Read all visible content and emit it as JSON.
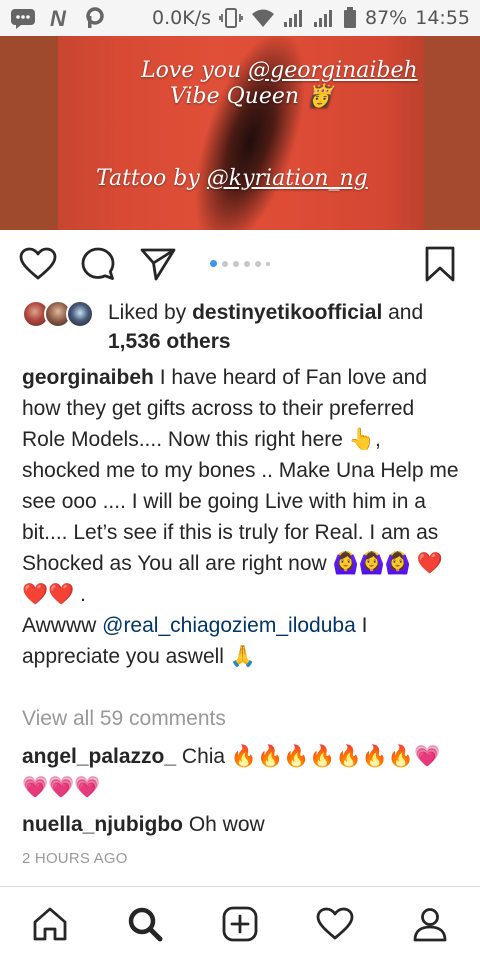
{
  "status_bar": {
    "network_speed": "0.0K/s",
    "battery": "87%",
    "time": "14:55",
    "left_icons": [
      "message-icon",
      "n-app-icon",
      "p-app-icon"
    ],
    "right_icons": [
      "vibrate-icon",
      "wifi-icon",
      "signal-icon",
      "signal-icon-2",
      "battery-icon"
    ]
  },
  "post_image": {
    "line1_prefix": "Love you ",
    "line1_handle": "@georginaibeh",
    "line2": "Vibe Queen 👸",
    "line3_prefix": "Tattoo by ",
    "line3_handle": "@kyriation_ng"
  },
  "actions": {
    "icons": [
      "heart-icon",
      "comment-icon",
      "share-icon",
      "bookmark-icon"
    ],
    "carousel_dots": 6,
    "active_dot": 0
  },
  "likes": {
    "liked_by_prefix": "Liked by ",
    "liked_by_user": "destinyetikoofficial",
    "and_text": " and",
    "others_count": "1,536 others"
  },
  "caption": {
    "username": "georginaibeh",
    "text": " I have heard of Fan love and how they get gifts across to their preferred Role Models.... Now this right here 👆, shocked me to my bones .. Make Una Help me see ooo .... I will be going Live with him in a bit.... Let’s see if this is truly for Real. I am as Shocked as You all are right now 🙆‍♀️🙆‍♀️🙆‍♀️ ❤️❤️❤️ .",
    "line2_prefix": "Awwww ",
    "line2_mention": "@real_chiagoziem_iloduba",
    "line2_suffix": " I appreciate you aswell 🙏"
  },
  "view_all_comments": "View all 59 comments",
  "comments": [
    {
      "username": "angel_palazzo_",
      "text": " Chia 🔥🔥🔥🔥🔥🔥🔥💗💗💗💗"
    },
    {
      "username": "nuella_njubigbo",
      "text": " Oh wow"
    }
  ],
  "timestamp": "2 HOURS AGO",
  "bottom_nav": [
    "home-icon",
    "search-icon",
    "add-post-icon",
    "activity-heart-icon",
    "profile-icon"
  ],
  "colors": {
    "link": "#003569",
    "muted": "#999999",
    "text": "#262626",
    "carousel_active": "#3897f0",
    "image_red": "#e04f38"
  }
}
